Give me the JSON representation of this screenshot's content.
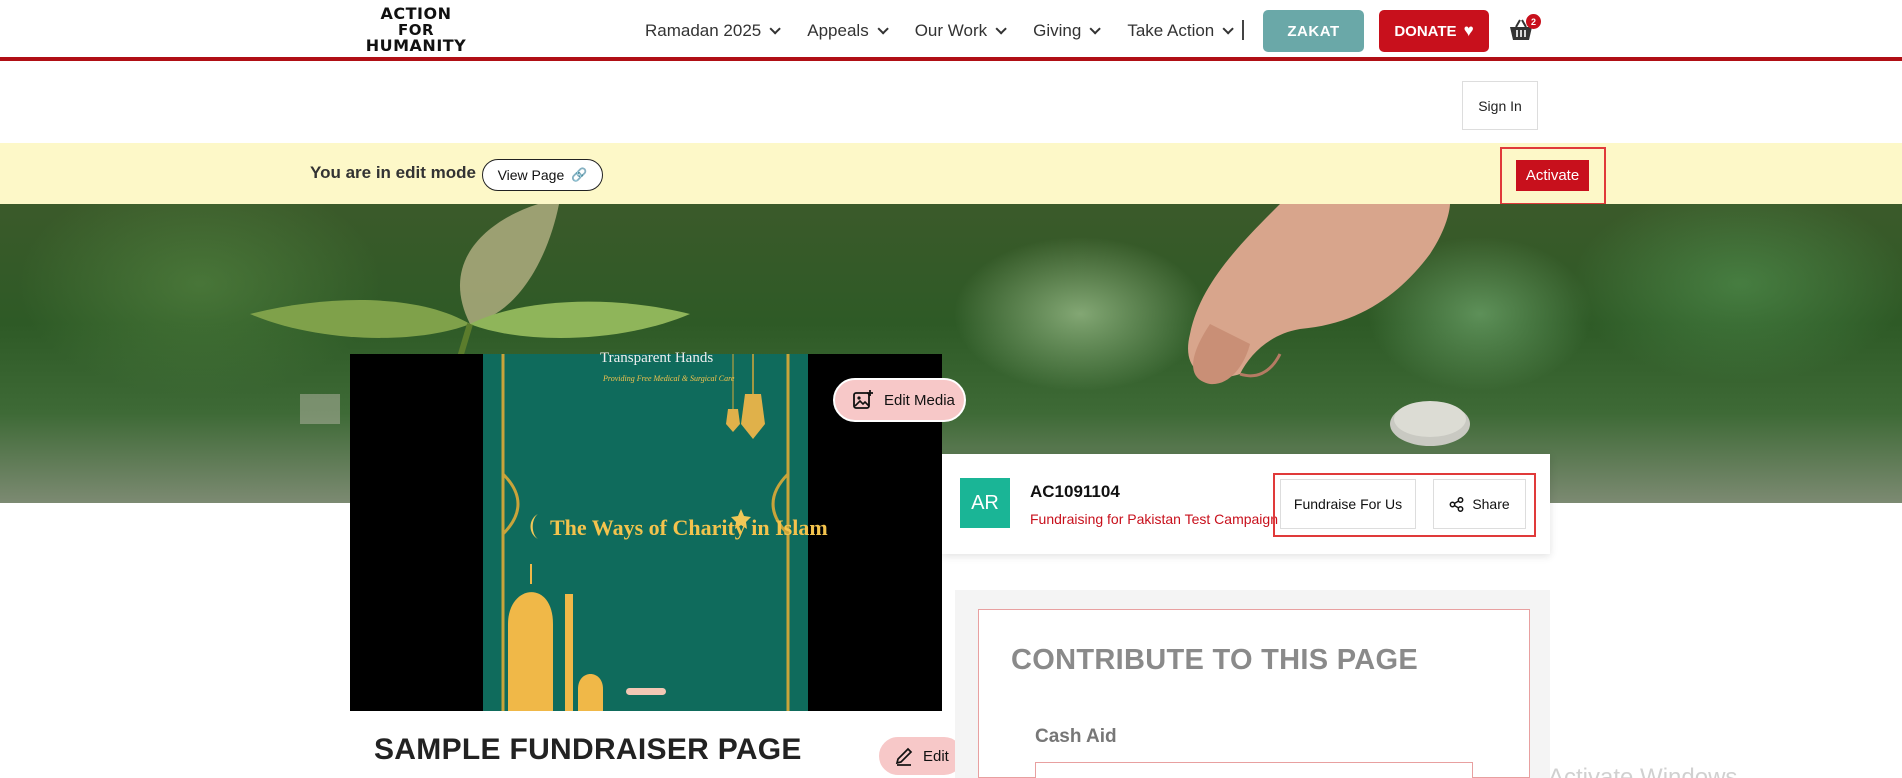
{
  "header": {
    "logo_line1": "ACTION",
    "logo_line2": "FOR",
    "logo_line3": "HUMANITY",
    "nav": [
      {
        "label": "Ramadan 2025"
      },
      {
        "label": "Appeals"
      },
      {
        "label": "Our Work"
      },
      {
        "label": "Giving"
      },
      {
        "label": "Take Action"
      }
    ],
    "zakat_label": "ZAKAT",
    "donate_label": "DONATE",
    "cart_count": "2"
  },
  "account": {
    "sign_in_label": "Sign In"
  },
  "edit_bar": {
    "text": "You are in edit mode",
    "view_page_label": "View Page",
    "activate_label": "Activate"
  },
  "media": {
    "brand": "Transparent Hands",
    "brand_tagline": "Providing Free Medical & Surgical Care",
    "slide_title": "The Ways of Charity in Islam",
    "edit_media_label": "Edit Media"
  },
  "campaign": {
    "avatar_initials": "AR",
    "id": "AC1091104",
    "subtitle": "Fundraising for Pakistan Test Campaign",
    "fundraise_label": "Fundraise For Us",
    "share_label": "Share"
  },
  "fundraiser": {
    "title": "SAMPLE FUNDRAISER PAGE",
    "edit_label": "Edit"
  },
  "contribute": {
    "title": "CONTRIBUTE TO THIS PAGE",
    "cash_aid_label": "Cash Aid"
  },
  "system": {
    "watermark": "Activate Windows"
  },
  "colors": {
    "brand_red": "#c8101c",
    "zakat_teal": "#6aa8a8",
    "edit_bar_bg": "#fdf8c8",
    "avatar_green": "#1ab596"
  }
}
